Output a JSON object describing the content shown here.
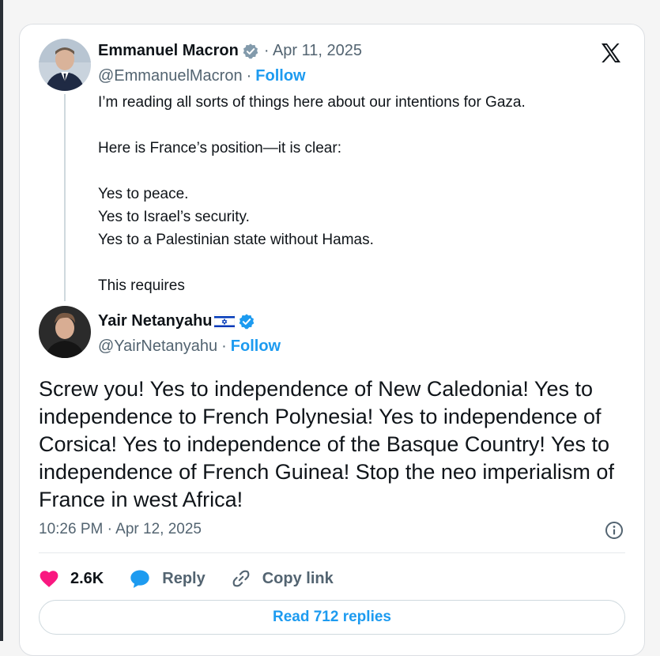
{
  "quoted_tweet": {
    "author_name": "Emmanuel Macron",
    "date": "· Apr 11, 2025",
    "handle": "@EmmanuelMacron",
    "separator": "·",
    "follow_label": "Follow",
    "text_lines": [
      "I’m reading all sorts of things here about our intentions for Gaza.",
      "",
      "Here is France’s position—it is clear:",
      "",
      "Yes to peace.",
      "Yes to Israel’s security.",
      "Yes to a Palestinian state without Hamas.",
      "",
      "This requires"
    ]
  },
  "reply_tweet": {
    "author_name": "Yair Netanyahu",
    "handle": "@YairNetanyahu",
    "separator": "·",
    "follow_label": "Follow",
    "text": "Screw you! Yes to independence of New Caledonia! Yes to independence to French Polynesia! Yes to independence of Corsica! Yes to independence of the Basque Country! Yes to independence of French Guinea! Stop the neo imperialism of France in west Africa!",
    "timestamp": "10:26 PM · Apr 12, 2025"
  },
  "actions": {
    "likes": "2.6K",
    "reply_label": "Reply",
    "copy_link_label": "Copy link",
    "read_replies_label": "Read 712 replies"
  },
  "colors": {
    "link_blue": "#1d9bf0",
    "like_pink": "#f91880",
    "muted_text": "#536471"
  },
  "icons": [
    "x-logo-icon",
    "verified-badge-icon",
    "israel-flag-icon",
    "info-icon",
    "heart-icon",
    "speech-bubble-icon",
    "link-icon"
  ]
}
